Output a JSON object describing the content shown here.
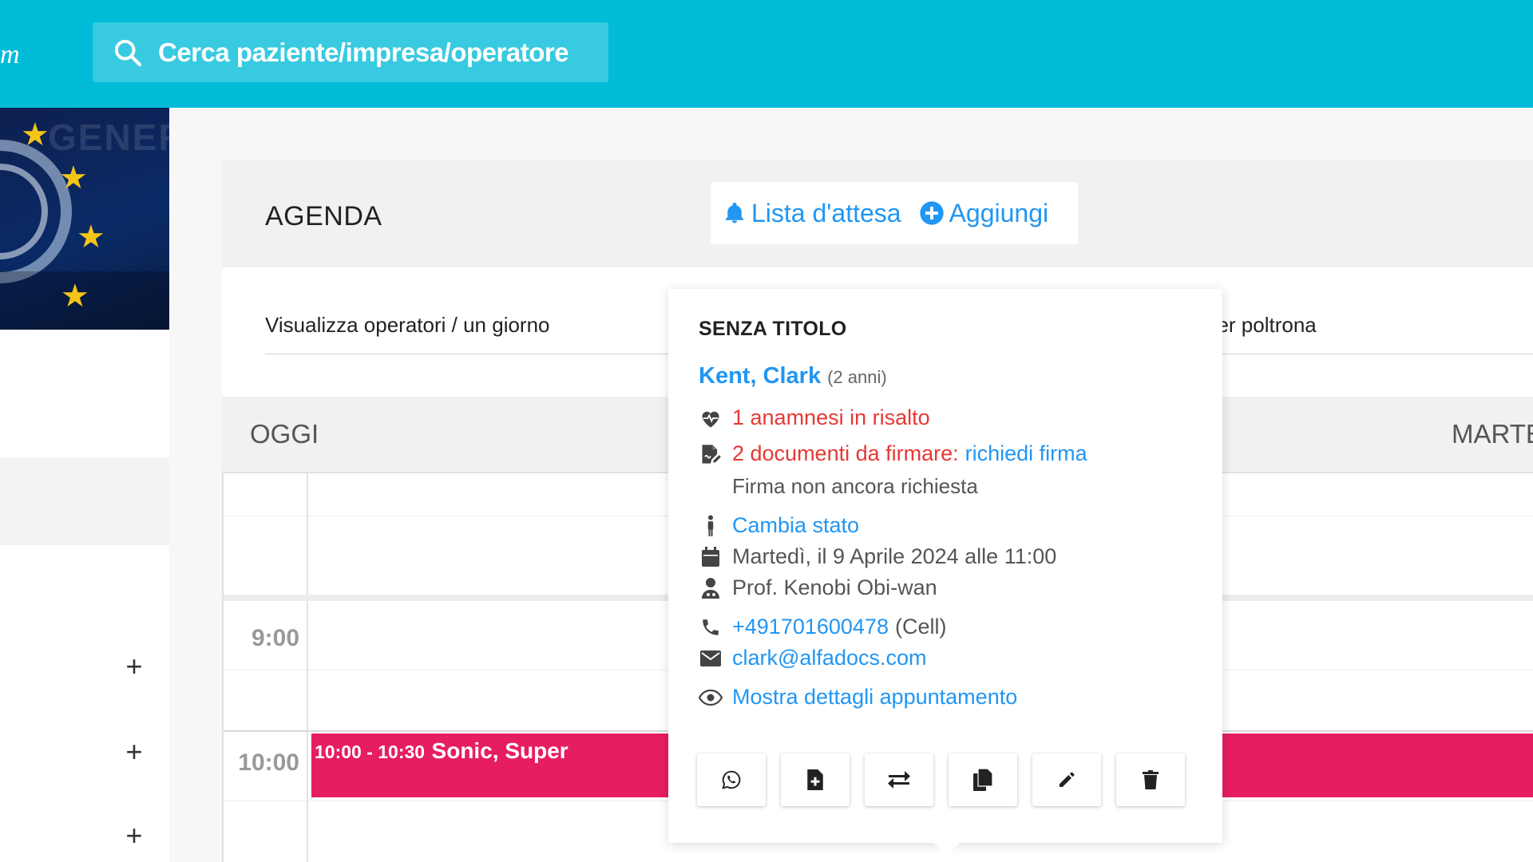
{
  "topbar": {
    "brand_fragment": "m",
    "search_placeholder": "Cerca paziente/impresa/operatore"
  },
  "logo": {
    "word": "GENERI"
  },
  "agenda": {
    "title": "AGENDA",
    "waitlist_label": "Lista d'attesa",
    "add_label": "Aggiungi",
    "view_select": "Visualizza operatori / un giorno",
    "view_select_right": "per poltrona",
    "today_label": "OGGI",
    "day_label": "MARTEDÌ"
  },
  "grid": {
    "times": [
      "9:00",
      "10:00"
    ],
    "appointment": {
      "time": "10:00 - 10:30",
      "name": "Sonic, Super"
    }
  },
  "popover": {
    "title": "SENZA TITOLO",
    "patient_name": "Kent, Clark",
    "patient_age": "(2 anni)",
    "anamnesis": "1 anamnesi in risalto",
    "documents_prefix": "2 documenti da firmare:",
    "documents_link": "richiedi firma",
    "signature_status": "Firma non ancora richiesta",
    "change_state": "Cambia stato",
    "datetime": "Martedì, il 9 Aprile 2024 alle 11:00",
    "operator": "Prof. Kenobi Obi-wan",
    "phone": "+491701600478",
    "phone_type": "(Cell)",
    "email": "clark@alfadocs.com",
    "show_details": "Mostra dettagli appuntamento",
    "buttons": [
      "whatsapp-icon",
      "add-document-icon",
      "swap-icon",
      "copy-icon",
      "edit-icon",
      "delete-icon"
    ]
  },
  "colors": {
    "topbar": "#00bcd8",
    "link": "#2196f3",
    "alert": "#e53935",
    "appointment": "#e71d63"
  }
}
